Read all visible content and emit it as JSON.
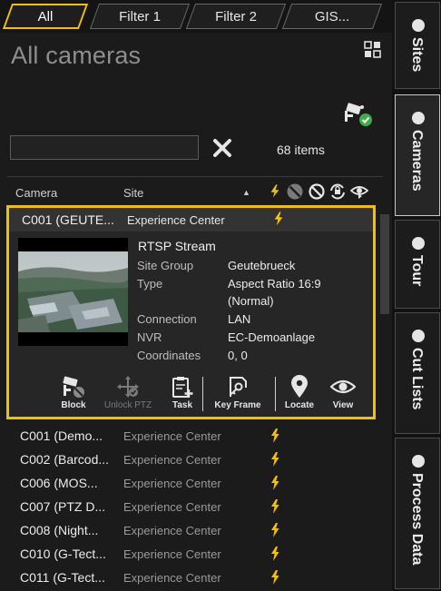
{
  "tabs": [
    {
      "label": "All",
      "active": true
    },
    {
      "label": "Filter 1",
      "active": false
    },
    {
      "label": "Filter 2",
      "active": false
    },
    {
      "label": "GIS...",
      "active": false
    }
  ],
  "page_title": "All cameras",
  "search": {
    "value": "",
    "placeholder": ""
  },
  "items_count": "68 items",
  "columns": {
    "camera": "Camera",
    "site": "Site"
  },
  "selected": {
    "camera": "C001  (GEUTE...",
    "site": "Experience Center",
    "stream": "RTSP Stream",
    "properties": [
      {
        "label": "Site Group",
        "value": "Geutebrueck"
      },
      {
        "label": "Type",
        "value": "Aspect Ratio 16:9"
      },
      {
        "label": "",
        "value": "(Normal)"
      },
      {
        "label": "Connection",
        "value": "LAN"
      },
      {
        "label": "NVR",
        "value": "EC-Demoanlage"
      },
      {
        "label": "Coordinates",
        "value": "0, 0"
      }
    ],
    "actions": [
      {
        "label": "Block",
        "icon": "camera-block-icon",
        "enabled": true
      },
      {
        "label": "Unlock PTZ",
        "icon": "ptz-unlock-icon",
        "enabled": false
      },
      {
        "label": "Task",
        "icon": "clipboard-add-icon",
        "enabled": true
      },
      {
        "label": "Key Frame",
        "icon": "key-frame-icon",
        "enabled": true
      },
      {
        "label": "Locate",
        "icon": "map-pin-icon",
        "enabled": true
      },
      {
        "label": "View",
        "icon": "eye-icon",
        "enabled": true
      }
    ]
  },
  "cameras": [
    {
      "camera": "C001  (Demo...",
      "site": "Experience Center"
    },
    {
      "camera": "C002  (Barcod...",
      "site": "Experience Center"
    },
    {
      "camera": "C006  (MOS...",
      "site": "Experience Center"
    },
    {
      "camera": "C007  (PTZ D...",
      "site": "Experience Center"
    },
    {
      "camera": "C008  (Night...",
      "site": "Experience Center"
    },
    {
      "camera": "C010   (G-Tect...",
      "site": "Experience Center"
    },
    {
      "camera": "C011   (G-Tect...",
      "site": "Experience Center"
    }
  ],
  "sidebar": [
    {
      "label": "Sites",
      "active": false
    },
    {
      "label": "Cameras",
      "active": true
    },
    {
      "label": "Tour",
      "active": false
    },
    {
      "label": "Cut Lists",
      "active": false
    },
    {
      "label": "Process Data",
      "active": false
    }
  ],
  "colors": {
    "accent": "#f2c100",
    "background": "#1b1b1b",
    "status_ok": "#3fae49"
  }
}
